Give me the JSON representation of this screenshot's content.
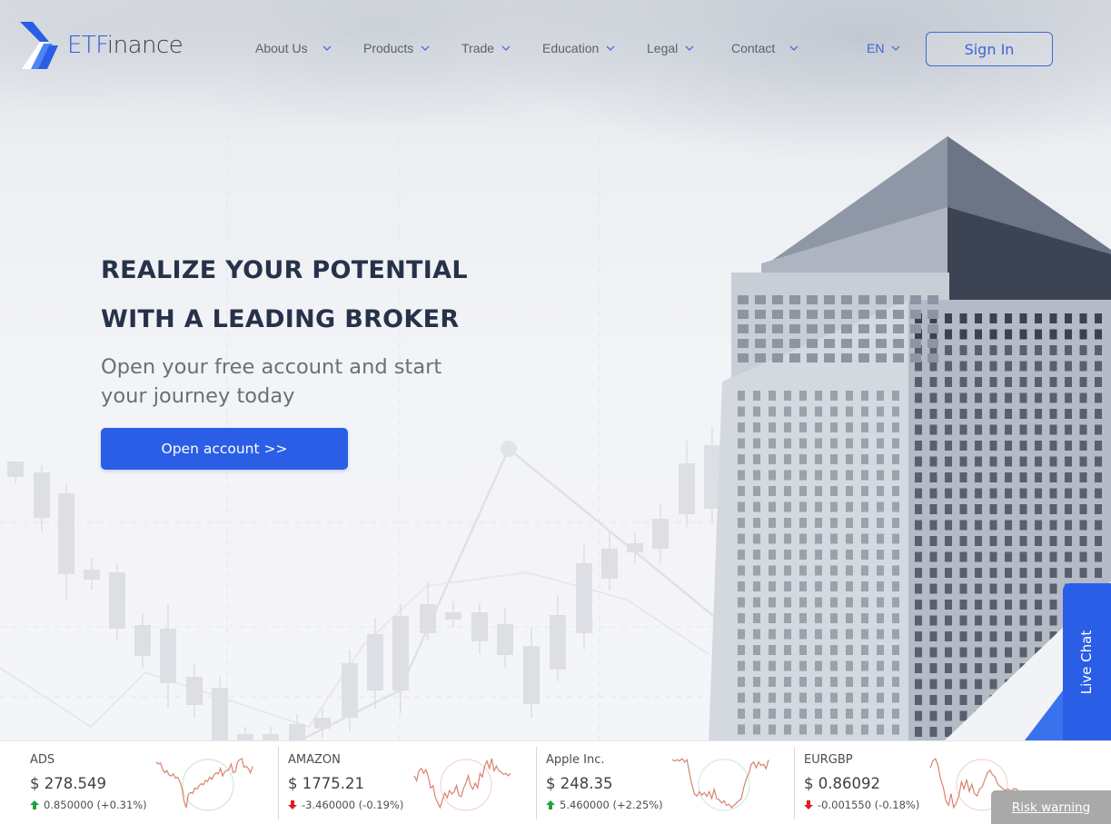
{
  "brand": {
    "name_prefix": "ETF",
    "name_suffix": "inance",
    "accent_color": "#2a5ee6"
  },
  "nav": {
    "items": [
      {
        "label": "About Us",
        "icon": "chevron-down-icon"
      },
      {
        "label": "Products",
        "icon": "chevron-down-icon"
      },
      {
        "label": "Trade",
        "icon": "chevron-down-icon"
      },
      {
        "label": "Education",
        "icon": "chevron-down-icon"
      },
      {
        "label": "Legal",
        "icon": "chevron-down-icon"
      },
      {
        "label": "Contact",
        "icon": "chevron-down-icon"
      }
    ],
    "language": "EN",
    "sign_in_label": "Sign In"
  },
  "hero": {
    "headline_line1": "REALIZE YOUR POTENTIAL",
    "headline_line2": "WITH A LEADING BROKER",
    "subheadline": "Open your free account and start your journey today",
    "cta_label": "Open account >>"
  },
  "live_chat": {
    "label": "Live Chat"
  },
  "ticker": [
    {
      "name": "ADS",
      "price": "$ 278.549",
      "change": "0.850000 (+0.31%)",
      "direction": "up",
      "circle_color": "#cfe7dd",
      "spark": [
        62,
        60,
        61,
        55,
        52,
        54,
        50,
        49,
        51,
        47,
        48,
        44,
        38,
        26,
        20,
        32,
        34,
        33,
        38,
        37,
        40,
        42,
        41,
        45,
        44,
        48,
        46,
        50,
        52,
        51,
        56,
        49,
        53,
        54,
        55,
        60,
        52,
        53,
        62,
        64,
        65,
        57,
        58,
        56,
        52,
        58
      ]
    },
    {
      "name": "AMAZON",
      "price": "$ 1775.21",
      "change": "-3.460000 (-0.19%)",
      "direction": "down",
      "circle_color": "#f1d6d3",
      "spark": [
        48,
        44,
        52,
        54,
        50,
        53,
        47,
        38,
        40,
        30,
        26,
        22,
        28,
        34,
        30,
        36,
        33,
        35,
        40,
        32,
        31,
        38,
        42,
        48,
        40,
        37,
        42,
        38,
        50,
        47,
        56,
        60,
        54,
        62,
        52,
        56,
        52,
        51,
        49,
        50,
        48,
        50
      ]
    },
    {
      "name": "Apple Inc.",
      "price": "$ 248.35",
      "change": "5.460000 (+2.25%)",
      "direction": "up",
      "circle_color": "#d6ece2",
      "spark": [
        62,
        61,
        62,
        61,
        63,
        60,
        62,
        50,
        40,
        32,
        30,
        34,
        31,
        33,
        30,
        34,
        28,
        36,
        28,
        27,
        24,
        26,
        22,
        23,
        20,
        22,
        24,
        26,
        28,
        38,
        45,
        50,
        58,
        60,
        55,
        60,
        57,
        58,
        54,
        62
      ]
    },
    {
      "name": "EURGBP",
      "price": "$ 0.86092",
      "change": "-0.001550 (-0.18%)",
      "direction": "down",
      "circle_color": "#f1d6d3",
      "spark": [
        58,
        64,
        66,
        60,
        48,
        42,
        30,
        26,
        36,
        24,
        28,
        34,
        46,
        40,
        48,
        38,
        44,
        36,
        34,
        40,
        42,
        48,
        54,
        56,
        52,
        50,
        44,
        42,
        40,
        39,
        40,
        38,
        40,
        40,
        38,
        37,
        36,
        34
      ]
    }
  ],
  "risk_warning_label": "Risk warning",
  "colors": {
    "up": "#1fa33a",
    "down": "#d9201f",
    "spark_line": "#d9826c"
  }
}
